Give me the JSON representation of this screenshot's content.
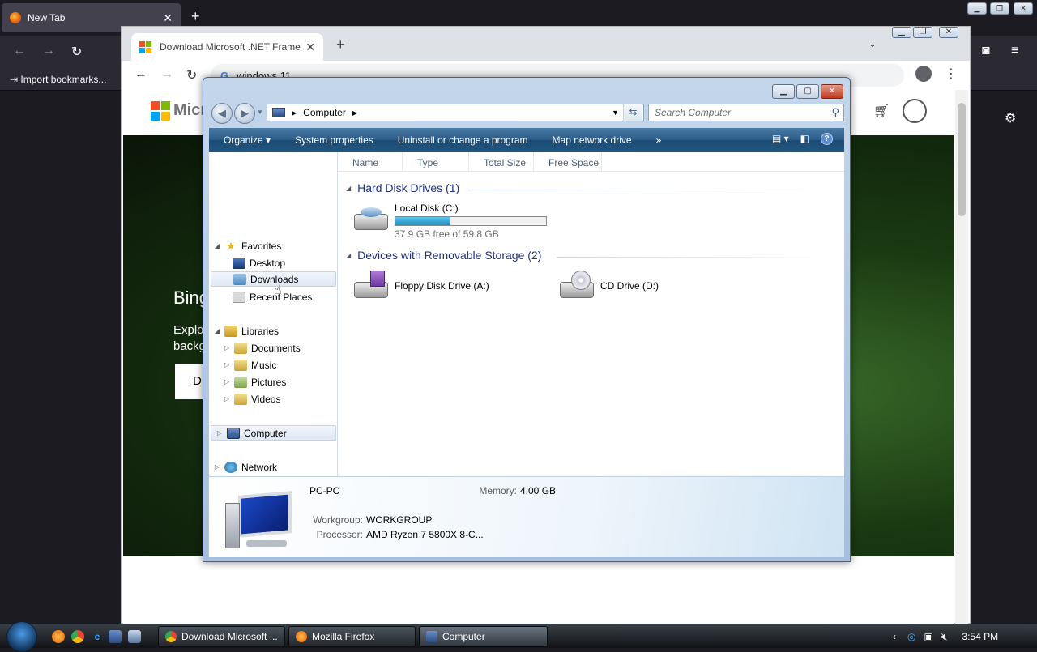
{
  "firefox": {
    "tab_title": "New Tab",
    "bookmarks_import": "Import bookmarks..."
  },
  "chrome": {
    "tab_title": "Download Microsoft .NET Frame",
    "omnibox_text": "windows 11",
    "ms_logo_text": "Micr",
    "hero_title": "Bing",
    "hero_line1": "Explo",
    "hero_line2": "backg",
    "hero_btn": "D"
  },
  "explorer": {
    "breadcrumb": "Computer",
    "search_placeholder": "Search Computer",
    "commands": [
      "Organize",
      "System properties",
      "Uninstall or change a program",
      "Map network drive"
    ],
    "more_chevrons": "»",
    "nav": {
      "favorites": "Favorites",
      "desktop": "Desktop",
      "downloads": "Downloads",
      "recent_places": "Recent Places",
      "libraries": "Libraries",
      "documents": "Documents",
      "music": "Music",
      "pictures": "Pictures",
      "videos": "Videos",
      "computer": "Computer",
      "network": "Network"
    },
    "columns": [
      "Name",
      "Type",
      "Total Size",
      "Free Space"
    ],
    "groups": {
      "hdd_title": "Hard Disk Drives (1)",
      "removable_title": "Devices with Removable Storage (2)"
    },
    "drives": {
      "c_name": "Local Disk (C:)",
      "c_free": "37.9 GB free of 59.8 GB",
      "c_used_fraction": 0.366,
      "a_name": "Floppy Disk Drive (A:)",
      "d_name": "CD Drive (D:)"
    },
    "details": {
      "pc_name": "PC-PC",
      "memory_label": "Memory:",
      "memory_value": "4.00 GB",
      "workgroup_label": "Workgroup:",
      "workgroup_value": "WORKGROUP",
      "processor_label": "Processor:",
      "processor_value": "AMD Ryzen 7 5800X 8-C..."
    }
  },
  "taskbar": {
    "btn_chrome": "Download Microsoft ...",
    "btn_firefox": "Mozilla Firefox",
    "btn_explorer": "Computer",
    "clock": "3:54 PM"
  }
}
